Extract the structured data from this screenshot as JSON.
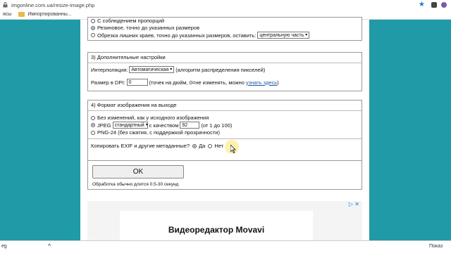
{
  "browser": {
    "url": "imgonline.com.ua/resize-image.php",
    "bookmarks": [
      {
        "label": "ясы"
      },
      {
        "label": "Импортированны..."
      }
    ],
    "colors": {
      "star": "#1a73e8",
      "page_bg": "#1f9aa6"
    }
  },
  "section2": {
    "options": [
      {
        "label": "С соблюдением пропорций",
        "selected": false
      },
      {
        "label": "Резиновое, точно до указанных размеров",
        "selected": true
      },
      {
        "label": "Обрезка лишних краев, точно до указанных размеров, оставить:",
        "selected": false
      }
    ],
    "crop_select_value": "центральную часть"
  },
  "section3": {
    "header": "3) Дополнительные настройки",
    "interp_label": "Интерполяция:",
    "interp_value": "Автоматическая",
    "interp_note": "(алгоритм распределения пикселей)",
    "dpi_label": "Размер в DPI:",
    "dpi_value": "0",
    "dpi_note": "(точек на дюйм, 0=не изменять, можно",
    "dpi_link": "узнать здесь",
    "dpi_close": ")"
  },
  "section4": {
    "header": "4) Формат изображения на выходе",
    "opt_nochange": "Без изменений, как у исходного изображения",
    "opt_jpeg": "JPEG",
    "jpeg_mode": "стандартный",
    "quality_label": "с качеством",
    "quality_value": "92",
    "quality_range": "(от 1 до 100)",
    "opt_png": "PNG-24 (без сжатия, с поддержкой прозрачности)",
    "exif_label": "Копировать EXIF и другие метаданные?",
    "exif_yes": "Да",
    "exif_no": "Нет"
  },
  "submit": {
    "button_label": "OK",
    "note": "Обработка обычно длится 0.5-30 секунд"
  },
  "ad": {
    "title": "Видеоредактор Movavi",
    "icons": "▷ ✕"
  },
  "download_bar": {
    "file": "eg",
    "right_label": "Показ"
  }
}
